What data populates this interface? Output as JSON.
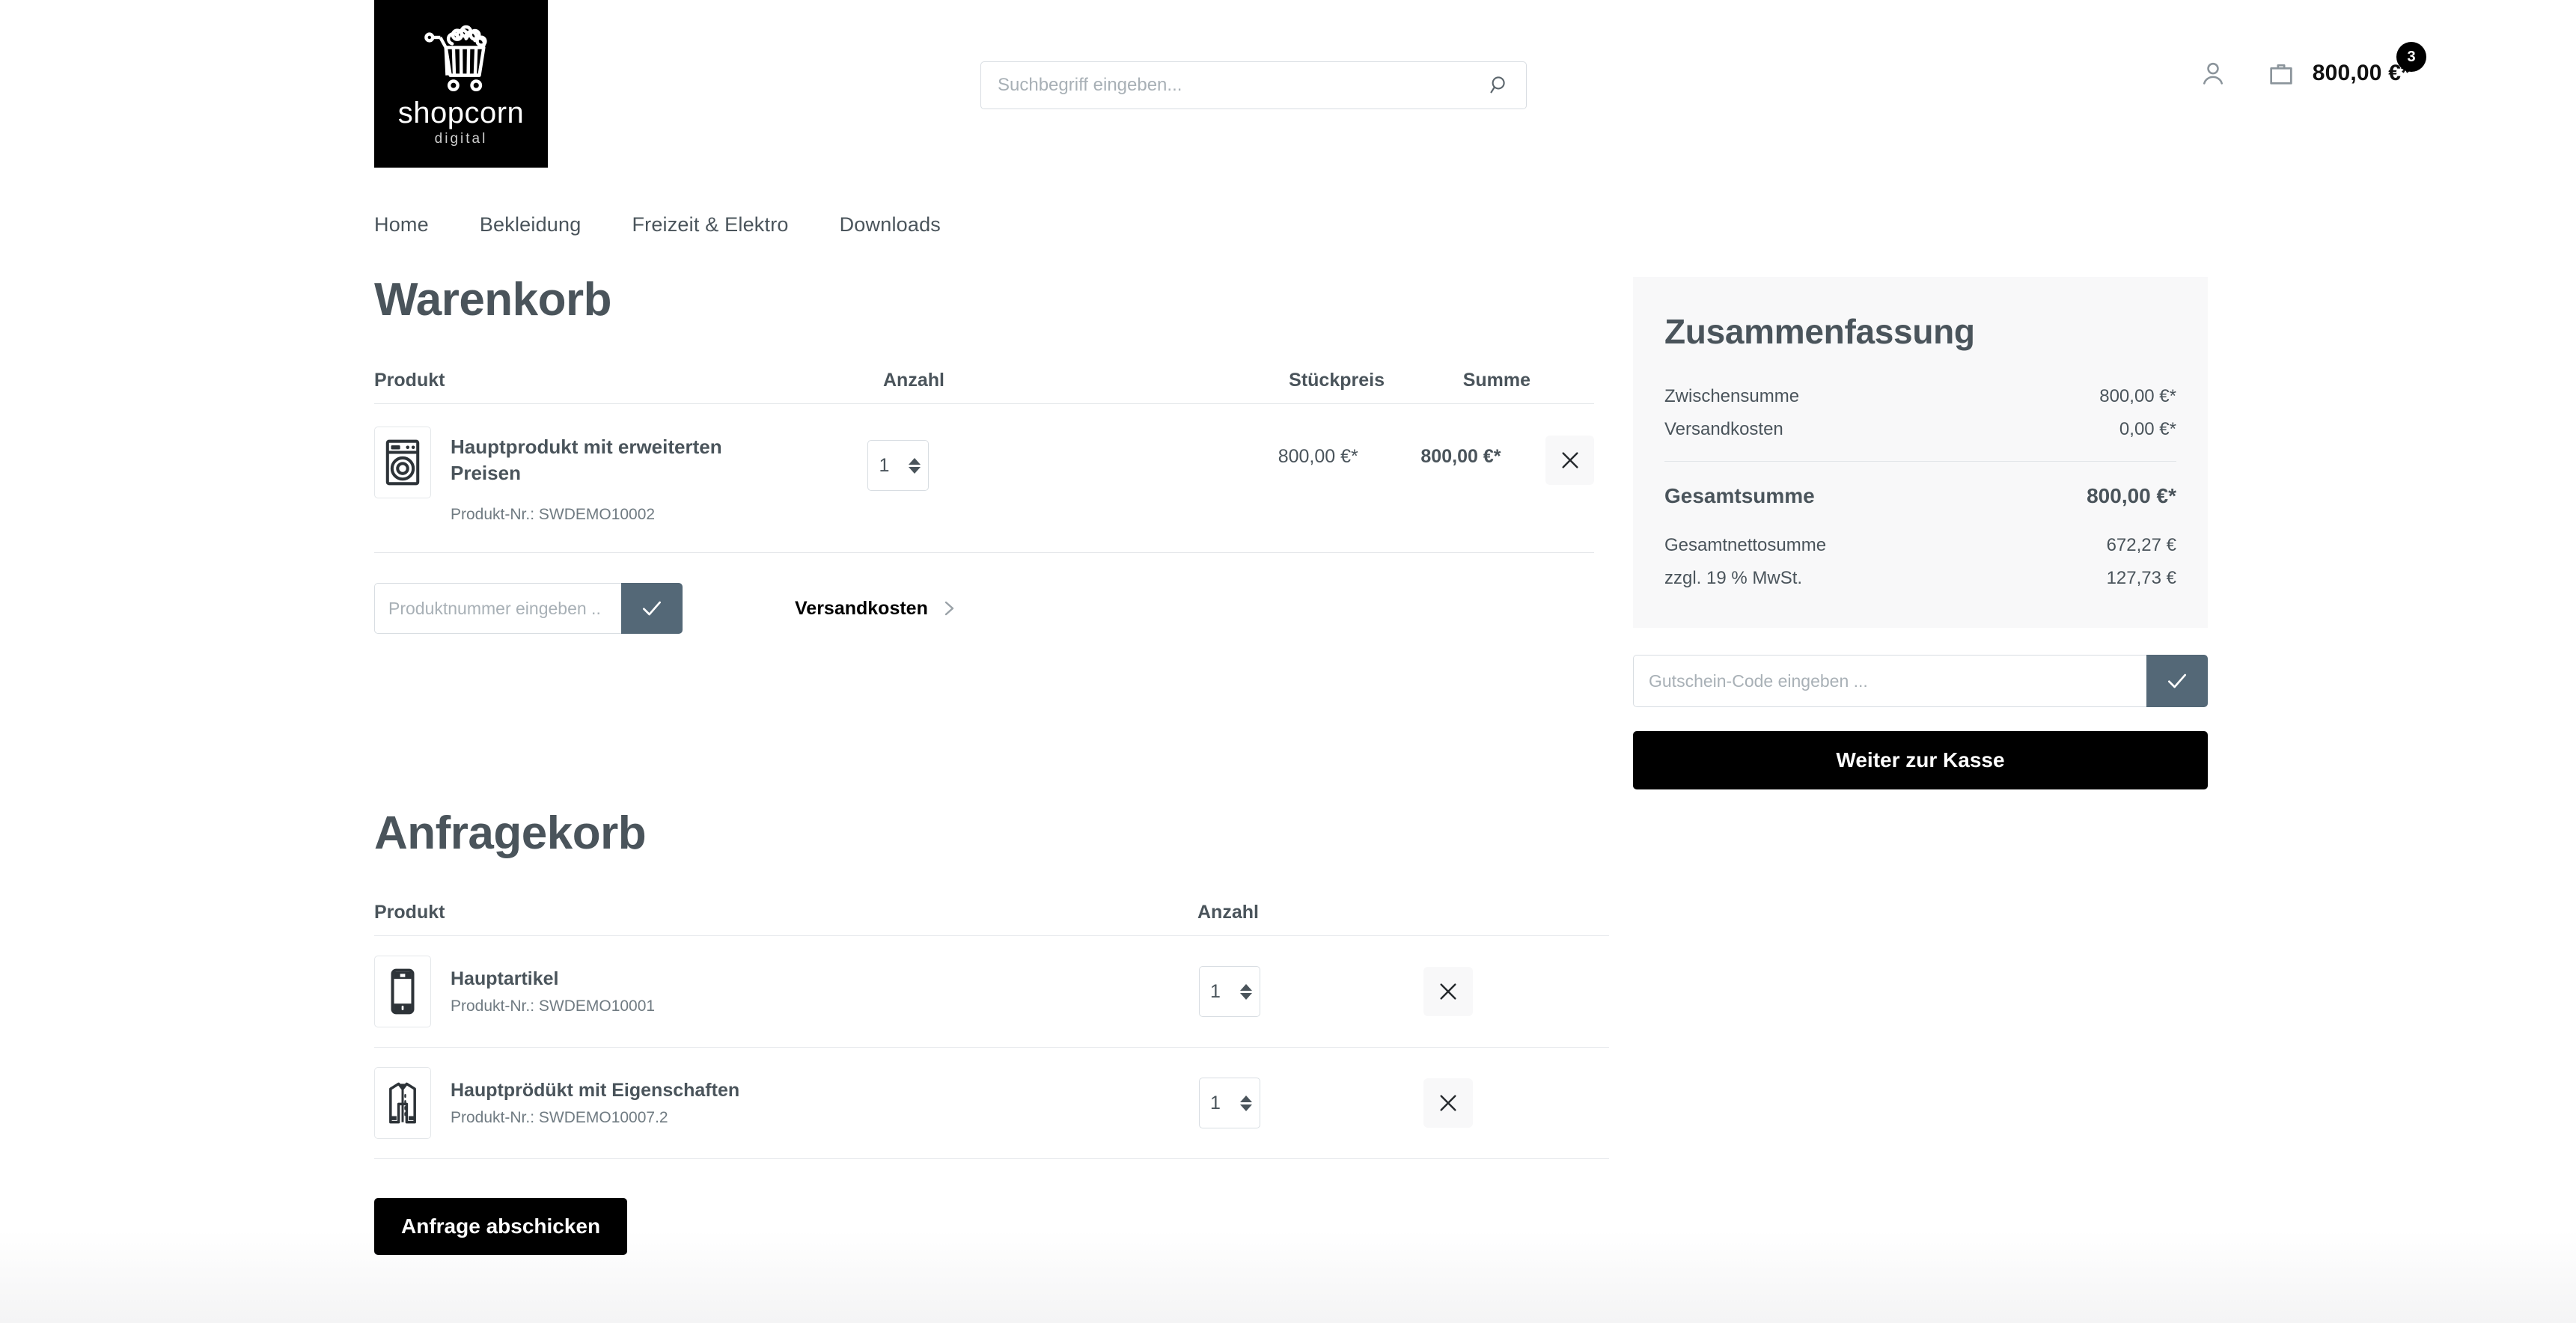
{
  "brand": {
    "name": "shopcorn",
    "tagline": "digital",
    "logo_icon": "popcorn-cart-icon"
  },
  "search": {
    "placeholder": "Suchbegriff eingeben...",
    "value": "",
    "icon": "search-icon"
  },
  "header": {
    "account_icon": "user-icon",
    "cart_icon": "shopping-bag-icon",
    "cart_total": "800,00 €*",
    "cart_count": "3"
  },
  "nav": {
    "items": [
      {
        "label": "Home"
      },
      {
        "label": "Bekleidung"
      },
      {
        "label": "Freizeit & Elektro"
      },
      {
        "label": "Downloads"
      }
    ]
  },
  "cart": {
    "title": "Warenkorb",
    "columns": {
      "product": "Produkt",
      "quantity": "Anzahl",
      "unit_price": "Stückpreis",
      "total": "Summe"
    },
    "rows": [
      {
        "thumb_icon": "washing-machine-icon",
        "name": "Hauptprodukt mit erweiterten Preisen",
        "product_nr": "Produkt-Nr.: SWDEMO10002",
        "quantity": "1",
        "unit_price": "800,00 €*",
        "total": "800,00 €*",
        "remove_icon": "close-icon"
      }
    ],
    "add_product": {
      "placeholder": "Produktnummer eingeben ..",
      "value": "",
      "submit_icon": "check-icon"
    },
    "shipping_link": {
      "label": "Versandkosten",
      "icon": "chevron-right-icon"
    }
  },
  "summary": {
    "title": "Zusammenfassung",
    "lines": [
      {
        "label": "Zwischensumme",
        "value": "800,00 €*"
      },
      {
        "label": "Versandkosten",
        "value": "0,00 €*"
      }
    ],
    "grand_total": {
      "label": "Gesamtsumme",
      "value": "800,00 €*"
    },
    "tax_lines": [
      {
        "label": "Gesamtnettosumme",
        "value": "672,27 €"
      },
      {
        "label": "zzgl. 19 % MwSt.",
        "value": "127,73 €"
      }
    ],
    "voucher": {
      "placeholder": "Gutschein-Code eingeben ...",
      "value": "",
      "submit_icon": "check-icon"
    },
    "checkout_label": "Weiter zur Kasse"
  },
  "inquiry": {
    "title": "Anfragekorb",
    "columns": {
      "product": "Produkt",
      "quantity": "Anzahl"
    },
    "rows": [
      {
        "thumb_icon": "smartphone-icon",
        "name": "Hauptartikel",
        "product_nr": "Produkt-Nr.: SWDEMO10001",
        "quantity": "1",
        "remove_icon": "close-icon"
      },
      {
        "thumb_icon": "jacket-icon",
        "name": "Hauptprödükt mit Eigenschaften",
        "product_nr": "Produkt-Nr.: SWDEMO10007.2",
        "quantity": "1",
        "remove_icon": "close-icon"
      }
    ],
    "submit_label": "Anfrage abschicken"
  },
  "colors": {
    "text_primary": "#4a545b",
    "text_muted": "#707b82",
    "accent_button": "#546877",
    "cta": "#000000",
    "panel_bg": "#f8f8f9",
    "border": "#e4e7ea"
  }
}
